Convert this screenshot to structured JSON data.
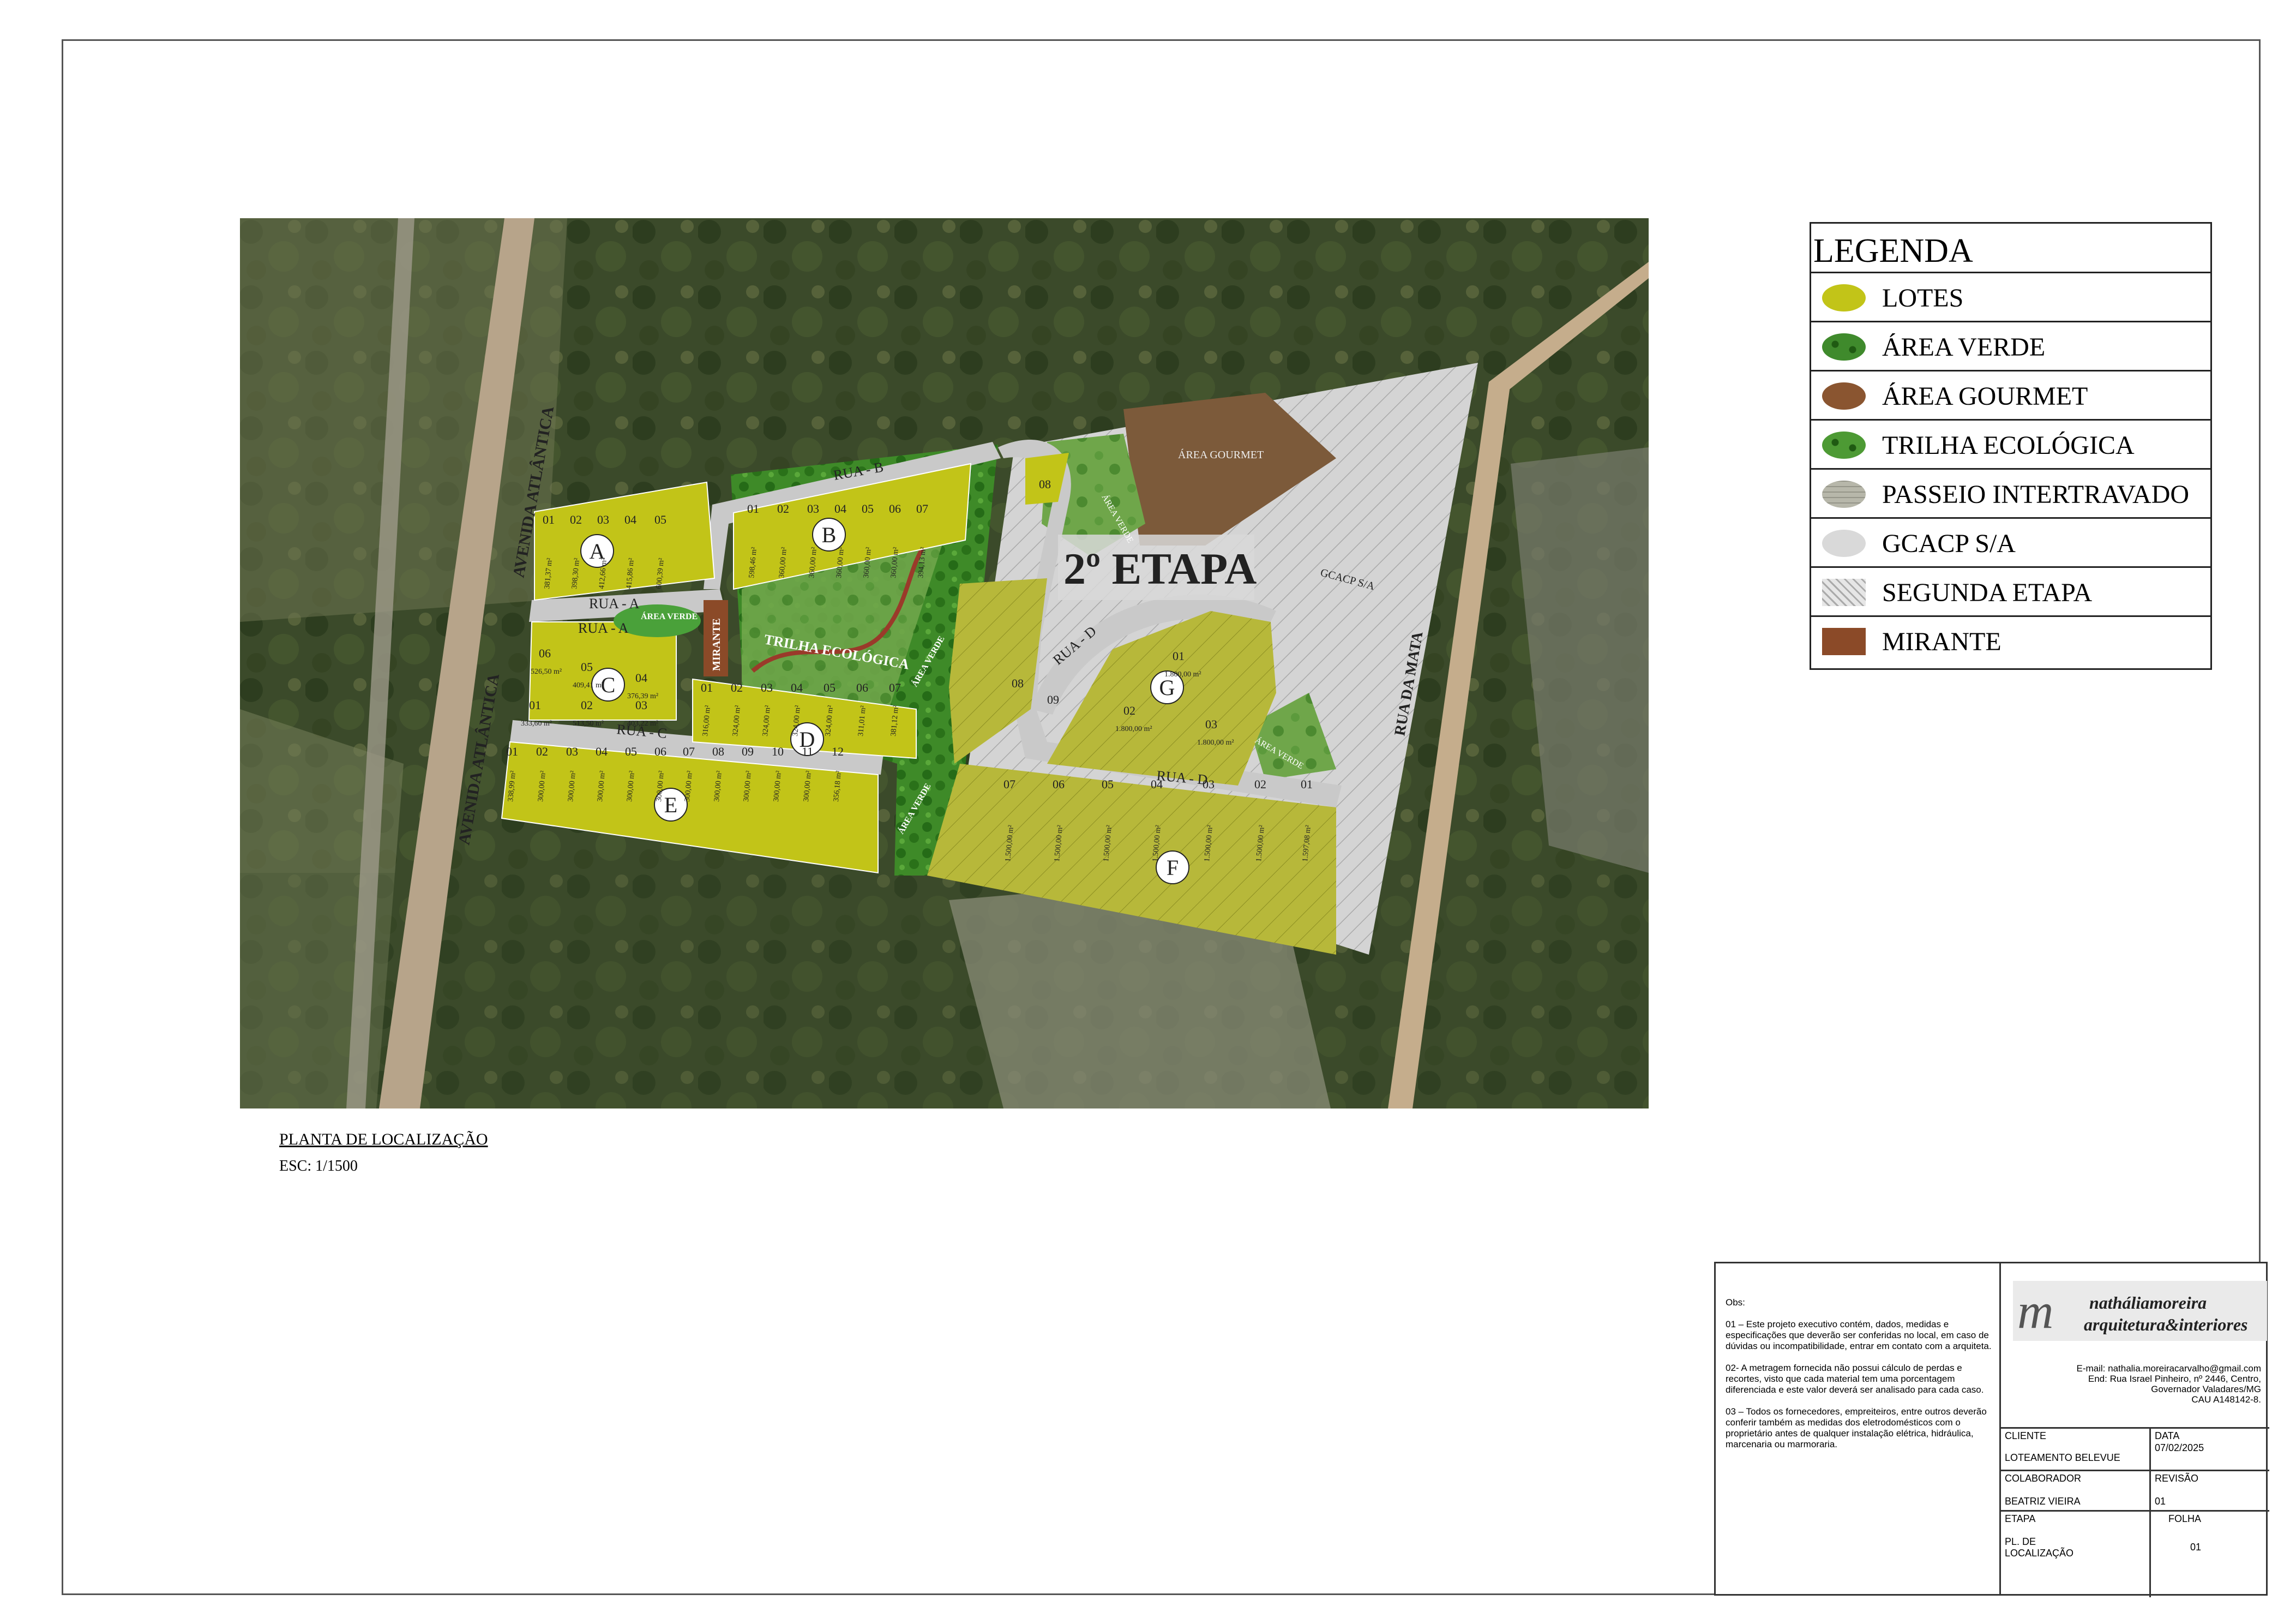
{
  "legend": {
    "title": "LEGENDA",
    "items": [
      {
        "label": "LOTES",
        "icon": "lotes-swatch",
        "color": "#c2c418"
      },
      {
        "label": "ÁREA VERDE",
        "icon": "area-verde-swatch",
        "color": "#3f8a2c"
      },
      {
        "label": "ÁREA GOURMET",
        "icon": "area-gourmet-swatch",
        "color": "#8a5530"
      },
      {
        "label": "TRILHA ECOLÓGICA",
        "icon": "trilha-swatch",
        "color": "#4d9a34"
      },
      {
        "label": "PASSEIO INTERTRAVADO",
        "icon": "passeio-swatch",
        "color": "#d8d8d0"
      },
      {
        "label": "GCACP S/A",
        "icon": "gcacp-swatch",
        "color": "#d9d9d9"
      },
      {
        "label": "SEGUNDA ETAPA",
        "icon": "segunda-etapa-swatch",
        "color": "#e6e6e6"
      },
      {
        "label": "MIRANTE",
        "icon": "mirante-swatch",
        "color": "#8b4a28"
      }
    ]
  },
  "map": {
    "streets": {
      "av_atlantica": "AVENIDA ATLÂNTICA",
      "rua_a": "RUA - A",
      "rua_b": "RUA - B",
      "rua_c": "RUA - C",
      "rua_d": "RUA - D",
      "rua_da_mata": "RUA DA MATA"
    },
    "labels": {
      "etapa2": "2º ETAPA",
      "area_gourmet": "ÁREA GOURMET",
      "gcacp": "GCACP S/A",
      "trilha": "TRILHA ECOLÓGICA",
      "mirante": "MIRANTE",
      "area_verde": "ÁREA VERDE"
    },
    "blocks": [
      {
        "letter": "A",
        "lots": [
          "01",
          "02",
          "03",
          "04",
          "05"
        ],
        "areas": [
          "381,37 m²",
          "398,30 m²",
          "412,66 m²",
          "415,86 m²",
          "600,39 m²"
        ]
      },
      {
        "letter": "B",
        "lots": [
          "01",
          "02",
          "03",
          "04",
          "05",
          "06",
          "07"
        ],
        "areas": [
          "598,46 m²",
          "360,00 m²",
          "360,00 m²",
          "360,00 m²",
          "360,00 m²",
          "360,00 m²",
          "394,13 m²"
        ]
      },
      {
        "letter": "C",
        "lots": [
          "01",
          "02",
          "03",
          "04",
          "05",
          "06"
        ],
        "areas": [
          "333,60 m²",
          "513,50 m²",
          "403,22 m²",
          "376,39 m²",
          "409,41 m²",
          "526,50 m²"
        ]
      },
      {
        "letter": "D",
        "lots": [
          "01",
          "02",
          "03",
          "04",
          "05",
          "06",
          "07"
        ],
        "areas": [
          "316,00 m²",
          "324,00 m²",
          "324,00 m²",
          "324,00 m²",
          "324,00 m²",
          "311,01 m²",
          "381,12 m²"
        ]
      },
      {
        "letter": "E",
        "lots": [
          "01",
          "02",
          "03",
          "04",
          "05",
          "06",
          "07",
          "08",
          "09",
          "10",
          "11",
          "12"
        ],
        "areas": [
          "338,99 m²",
          "300,00 m²",
          "300,00 m²",
          "300,00 m²",
          "300,00 m²",
          "300,00 m²",
          "300,00 m²",
          "300,00 m²",
          "300,00 m²",
          "300,00 m²",
          "300,00 m²",
          "356,18 m²"
        ]
      },
      {
        "letter": "F",
        "lots": [
          "07",
          "06",
          "05",
          "04",
          "03",
          "02",
          "01"
        ],
        "areas": [
          "1.500,00 m²",
          "1.500,00 m²",
          "1.500,00 m²",
          "1.500,00 m²",
          "1.500,00 m²",
          "1.500,00 m²",
          "1.597,08 m²"
        ]
      },
      {
        "letter": "G",
        "lots": [
          "01",
          "02",
          "03"
        ],
        "areas": [
          "1.800,00 m²",
          "1.800,00 m²",
          "1.800,00 m²"
        ]
      }
    ],
    "lot_08_upper": "08",
    "lot_08_left": "08",
    "lot_09_left": "09"
  },
  "caption": {
    "title": "PLANTA DE LOCALIZAÇÃO",
    "scale": "ESC: 1/1500"
  },
  "titleblock": {
    "obs_heading": "Obs:",
    "notes": [
      "01 – Este projeto executivo contém, dados, medidas e especificações que deverão ser conferidas no local, em caso de dúvidas ou incompatibilidade, entrar em contato com a arquiteta.",
      "02- A metragem fornecida não possui cálculo de perdas e recortes, visto que cada material tem uma porcentagem diferenciada e este valor deverá ser analisado para cada caso.",
      "03 – Todos os fornecedores, empreiteiros, entre outros deverão conferir também as medidas dos eletrodomésticos com o proprietário antes de qualquer instalação elétrica, hidráulica, marcenaria ou marmoraria."
    ],
    "logo_mark": "m",
    "logo_line1": "natháliamoreira",
    "logo_line2": "arquitetura&interiores",
    "contact": [
      "E-mail: nathalia.moreiracarvalho@gmail.com",
      "End: Rua Israel Pinheiro, nº 2446, Centro,",
      "Governador Valadares/MG",
      "CAU A148142-8."
    ],
    "cliente_label": "CLIENTE",
    "cliente_value": "LOTEAMENTO BELEVUE",
    "data_label": "DATA",
    "data_value": "07/02/2025",
    "colaborador_label": "COLABORADOR",
    "colaborador_value": "BEATRIZ VIEIRA",
    "revisao_label": "REVISÃO",
    "revisao_value": "01",
    "etapa_label": "ETAPA",
    "etapa_value": "PL. DE LOCALIZAÇÃO",
    "folha_label": "FOLHA",
    "folha_value": "01"
  }
}
